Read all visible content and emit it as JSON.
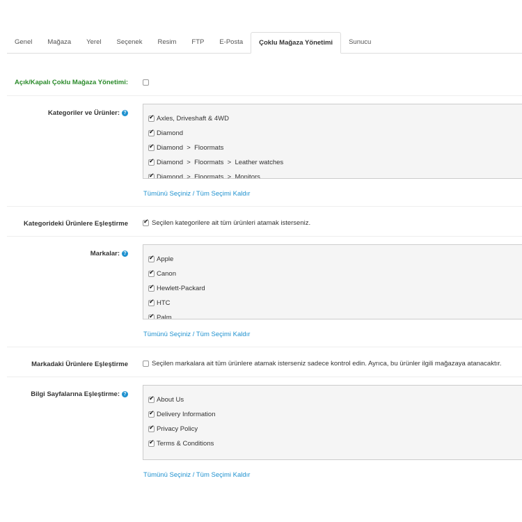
{
  "tabs": [
    "Genel",
    "Mağaza",
    "Yerel",
    "Seçenek",
    "Resim",
    "FTP",
    "E-Posta",
    "Çoklu Mağaza Yönetimi",
    "Sunucu"
  ],
  "active_tab": "Çoklu Mağaza Yönetimi",
  "toggle": {
    "label": "Açık/Kapalı Çoklu Mağaza Yönetimi:",
    "checked": false
  },
  "categories": {
    "label": "Kategoriler ve Ürünler:",
    "items": [
      {
        "label": "Axles, Driveshaft & 4WD",
        "checked": true
      },
      {
        "label": "Diamond",
        "checked": true
      },
      {
        "label": "Diamond  >  Floormats",
        "checked": true
      },
      {
        "label": "Diamond  >  Floormats  >  Leather watches",
        "checked": true
      },
      {
        "label": "Diamond  >  Floormats  >  Monitors",
        "checked": true
      }
    ],
    "select_all": "Tümünü Seçiniz",
    "separator": " / ",
    "deselect_all": "Tüm Seçimi Kaldır"
  },
  "category_products": {
    "label": "Kategorideki Ürünlere Eşleştirme",
    "checked": true,
    "text": "Seçilen kategorilere ait tüm ürünleri atamak isterseniz."
  },
  "brands": {
    "label": "Markalar:",
    "items": [
      {
        "label": "Apple",
        "checked": true
      },
      {
        "label": "Canon",
        "checked": true
      },
      {
        "label": "Hewlett-Packard",
        "checked": true
      },
      {
        "label": "HTC",
        "checked": true
      },
      {
        "label": "Palm",
        "checked": true
      }
    ],
    "select_all": "Tümünü Seçiniz",
    "separator": " / ",
    "deselect_all": "Tüm Seçimi Kaldır"
  },
  "brand_products": {
    "label": "Markadaki Ürünlere Eşleştirme",
    "checked": false,
    "text": "Seçilen markalara ait tüm ürünlere atamak isterseniz sadece kontrol edin. Ayrıca, bu ürünler ilgili mağazaya atanacaktır."
  },
  "info_pages": {
    "label": "Bilgi Sayfalarına Eşleştirme:",
    "items": [
      {
        "label": "About Us",
        "checked": true
      },
      {
        "label": "Delivery Information",
        "checked": true
      },
      {
        "label": "Privacy Policy",
        "checked": true
      },
      {
        "label": "Terms & Conditions",
        "checked": true
      }
    ],
    "select_all": "Tümünü Seçiniz",
    "separator": " / ",
    "deselect_all": "Tüm Seçimi Kaldır"
  },
  "help_icon": "question-circle-icon",
  "colors": {
    "accent": "#1e91cf",
    "green_label": "#2a8a2a"
  }
}
